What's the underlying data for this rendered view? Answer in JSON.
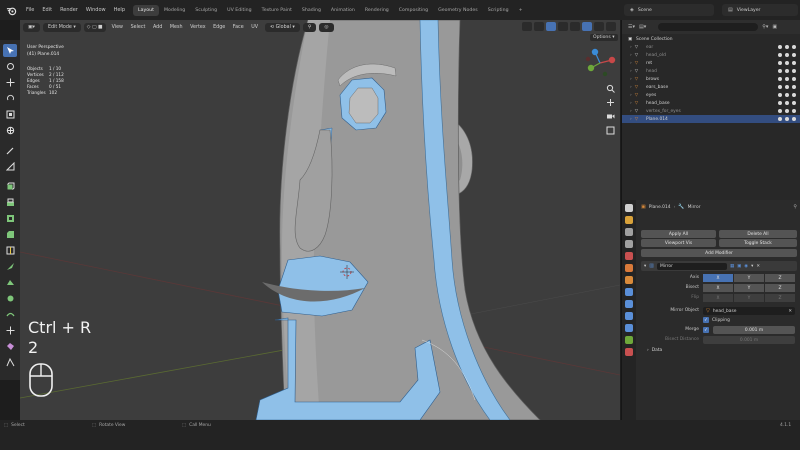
{
  "menubar": {
    "menus": [
      "File",
      "Edit",
      "Render",
      "Window",
      "Help"
    ],
    "workspaces": [
      {
        "label": "Layout",
        "active": true
      },
      {
        "label": "Modeling",
        "active": false
      },
      {
        "label": "Sculpting",
        "active": false
      },
      {
        "label": "UV Editing",
        "active": false
      },
      {
        "label": "Texture Paint",
        "active": false
      },
      {
        "label": "Shading",
        "active": false
      },
      {
        "label": "Animation",
        "active": false
      },
      {
        "label": "Rendering",
        "active": false
      },
      {
        "label": "Compositing",
        "active": false
      },
      {
        "label": "Geometry Nodes",
        "active": false
      },
      {
        "label": "Scripting",
        "active": false
      }
    ],
    "scene_label": "Scene",
    "view_layer_label": "ViewLayer"
  },
  "viewport": {
    "mode_label": "Edit Mode",
    "menus": [
      "View",
      "Select",
      "Add",
      "Mesh",
      "Vertex",
      "Edge",
      "Face",
      "UV"
    ],
    "orientation_label": "Global",
    "options_label": "Options",
    "info_line1": "User Perspective",
    "info_line2": "(41) Plane.014",
    "stats": [
      {
        "key": "Objects",
        "value": "1 / 10"
      },
      {
        "key": "Vertices",
        "value": "2 / 112"
      },
      {
        "key": "Edges",
        "value": "1 / 158"
      },
      {
        "key": "Faces",
        "value": "0 / 51"
      },
      {
        "key": "Triangles",
        "value": "102"
      }
    ],
    "key_combo": "Ctrl + R",
    "key_count": "2"
  },
  "outliner": {
    "root_label": "Scene Collection",
    "items": [
      {
        "name": "ear",
        "dim": true,
        "selected": false
      },
      {
        "name": "head_old",
        "dim": true,
        "selected": false
      },
      {
        "name": "ret",
        "dim": false,
        "selected": false
      },
      {
        "name": "head",
        "dim": true,
        "selected": false
      },
      {
        "name": "brows",
        "dim": false,
        "selected": false
      },
      {
        "name": "ears_base",
        "dim": false,
        "selected": false
      },
      {
        "name": "eyes",
        "dim": false,
        "selected": false
      },
      {
        "name": "head_base",
        "dim": false,
        "selected": false
      },
      {
        "name": "vertex_for_eyes",
        "dim": true,
        "selected": false
      },
      {
        "name": "Plane.014",
        "dim": false,
        "selected": true
      }
    ]
  },
  "properties": {
    "object_name": "Plane.014",
    "modifier_tab": "Mirror",
    "apply_all": "Apply All",
    "delete_all": "Delete All",
    "viewport_vis": "Viewport Vis",
    "toggle_stack": "Toggle Stack",
    "add_modifier": "Add Modifier",
    "modifier_name": "Mirror",
    "axis_label": "Axis",
    "bisect_label": "Bisect",
    "flip_label": "Flip",
    "x": "X",
    "y": "Y",
    "z": "Z",
    "mirror_object_label": "Mirror Object",
    "mirror_object_value": "head_base",
    "clipping_label": "Clipping",
    "merge_label": "Merge",
    "merge_value": "0.001 m",
    "bisect_distance_label": "Bisect Distance",
    "bisect_distance_value": "0.001 m",
    "data_label": "Data"
  },
  "statusbar": {
    "select": "Select",
    "rotate_view": "Rotate View",
    "call_menu": "Call Menu",
    "version": "4.1.1"
  },
  "colors": {
    "accent": "#4772b3",
    "mesh_face": "#8c8c8c",
    "selected_faces": "#8fc0e8"
  }
}
